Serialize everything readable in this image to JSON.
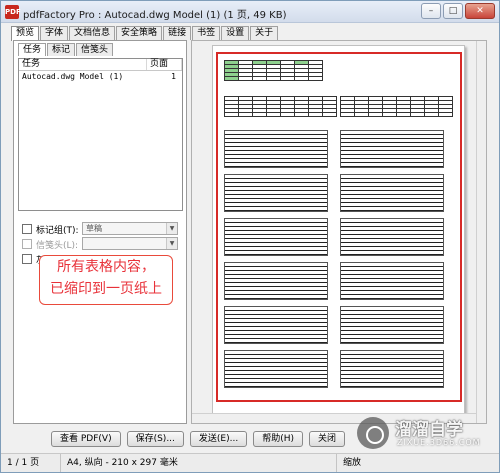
{
  "window": {
    "title": "pdfFactory Pro : Autocad.dwg Model (1) (1 页, 49 KB)",
    "icon_text": "PDF"
  },
  "tabs": [
    "预览",
    "字体",
    "文档信息",
    "安全策略",
    "链接",
    "书签",
    "设置",
    "关于"
  ],
  "subtabs": [
    "任务",
    "标记",
    "信笺头"
  ],
  "tasklist": {
    "col_task": "任务",
    "col_pages": "页面",
    "rows": [
      {
        "task": "Autocad.dwg Model (1)",
        "pages": "1"
      }
    ]
  },
  "options": {
    "mark_group_label": "标记组(T):",
    "mark_group_value": "草稿",
    "letterhead_label": "信笺头(L):",
    "grayscale_label": "灰阶(G)"
  },
  "annotation": {
    "line1": "所有表格内容，",
    "line2": "已缩印到一页纸上"
  },
  "buttons": {
    "view_pdf": "查看 PDF(V)",
    "save": "保存(S)...",
    "send": "发送(E)...",
    "help": "帮助(H)",
    "close": "关闭"
  },
  "status": {
    "page": "1 / 1 页",
    "paper": "A4, 纵向 - 210 x 297 毫米",
    "zoom": "缩放"
  },
  "watermark": {
    "cn": "溜溜自学",
    "en": "ZIXUE.3D66.COM"
  },
  "colors": {
    "accent_red": "#e8323a",
    "frame_red": "#d72a27"
  }
}
